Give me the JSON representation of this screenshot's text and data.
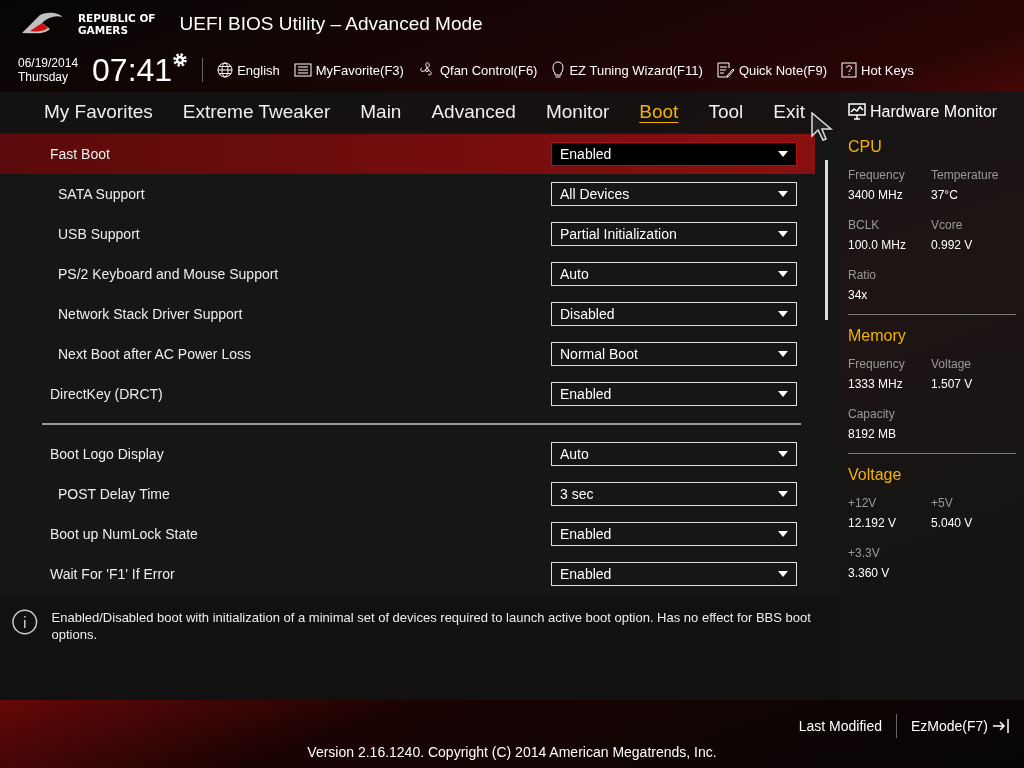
{
  "header": {
    "logo_text": [
      "REPUBLIC OF",
      "GAMERS"
    ],
    "title": "UEFI BIOS Utility – Advanced Mode"
  },
  "toolbar": {
    "date": "06/19/2014",
    "day": "Thursday",
    "time": "07:41",
    "items": [
      {
        "kind": "globe",
        "label": "English"
      },
      {
        "kind": "favorite",
        "label": "MyFavorite(F3)"
      },
      {
        "kind": "fan",
        "label": "Qfan Control(F6)"
      },
      {
        "kind": "bulb",
        "label": "EZ Tuning Wizard(F11)"
      },
      {
        "kind": "note",
        "label": "Quick Note(F9)"
      },
      {
        "kind": "help",
        "label": "Hot Keys"
      }
    ]
  },
  "tabs": [
    {
      "label": "My Favorites",
      "selected": false
    },
    {
      "label": "Extreme Tweaker",
      "selected": false
    },
    {
      "label": "Main",
      "selected": false
    },
    {
      "label": "Advanced",
      "selected": false
    },
    {
      "label": "Monitor",
      "selected": false
    },
    {
      "label": "Boot",
      "selected": true
    },
    {
      "label": "Tool",
      "selected": false
    },
    {
      "label": "Exit",
      "selected": false
    }
  ],
  "settings": [
    {
      "items": [
        {
          "label": "Fast Boot",
          "value": "Enabled",
          "selected": true,
          "children": [
            {
              "label": "SATA Support",
              "value": "All Devices",
              "selected": false
            },
            {
              "label": "USB Support",
              "value": "Partial Initialization",
              "selected": false
            },
            {
              "label": "PS/2 Keyboard and Mouse Support",
              "value": "Auto",
              "selected": false
            },
            {
              "label": "Network Stack Driver Support",
              "value": "Disabled",
              "selected": false
            },
            {
              "label": "Next Boot after AC Power Loss",
              "value": "Normal Boot",
              "selected": false
            }
          ]
        },
        {
          "label": "DirectKey (DRCT)",
          "value": "Enabled",
          "selected": false
        }
      ]
    },
    {
      "items": [
        {
          "label": "Boot Logo Display",
          "value": "Auto",
          "selected": false,
          "children": [
            {
              "label": "POST Delay Time",
              "value": "3 sec",
              "selected": false
            }
          ]
        },
        {
          "label": "Boot up NumLock State",
          "value": "Enabled",
          "selected": false
        },
        {
          "label": "Wait For 'F1' If Error",
          "value": "Enabled",
          "selected": false
        }
      ]
    }
  ],
  "help_text": "Enabled/Disabled boot with initialization of a minimal set of devices required to launch active boot option. Has no effect for BBS boot options.",
  "hardware_monitor": {
    "title": "Hardware Monitor",
    "sections": [
      {
        "title": "CPU",
        "readings": [
          {
            "label": "Frequency",
            "value": "3400 MHz"
          },
          {
            "label": "Temperature",
            "value": "37°C"
          },
          {
            "label": "BCLK",
            "value": "100.0 MHz"
          },
          {
            "label": "Vcore",
            "value": "0.992 V"
          },
          {
            "label": "Ratio",
            "value": "34x"
          }
        ]
      },
      {
        "title": "Memory",
        "readings": [
          {
            "label": "Frequency",
            "value": "1333 MHz"
          },
          {
            "label": "Voltage",
            "value": "1.507 V"
          },
          {
            "label": "Capacity",
            "value": "8192 MB"
          }
        ]
      },
      {
        "title": "Voltage",
        "readings": [
          {
            "label": "+12V",
            "value": "12.192 V"
          },
          {
            "label": "+5V",
            "value": "5.040 V"
          },
          {
            "label": "+3.3V",
            "value": "3.360 V"
          }
        ]
      }
    ]
  },
  "footer": {
    "last_modified": "Last Modified",
    "ez_mode": "EzMode(F7)",
    "version": "Version 2.16.1240. Copyright (C) 2014 American Megatrends, Inc."
  }
}
